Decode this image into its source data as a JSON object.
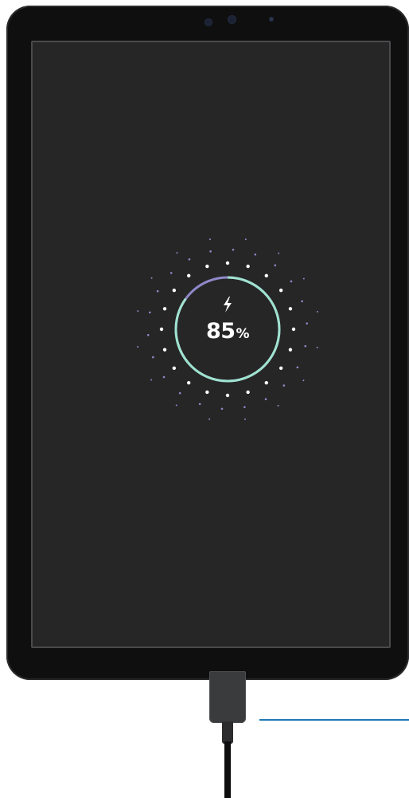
{
  "device": "tablet",
  "charging_screen": {
    "bolt_icon": "lightning-bolt-icon",
    "battery_level": 0.85,
    "percent_value": "85",
    "percent_sign": "%",
    "ring_color_charged": "#9fe3cf",
    "ring_color_remaining": "#8f88c8",
    "dot_color_near": "#ffffff",
    "dot_color_far": "#8f88c8"
  },
  "cable": {
    "connector": "usb-c-connector",
    "callout_line_color": "#1f78b4"
  }
}
